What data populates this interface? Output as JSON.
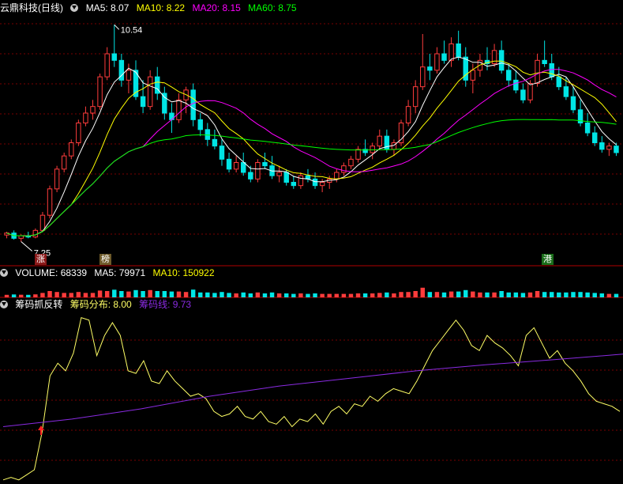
{
  "panels": {
    "main": {
      "title": "云鼎科技(日线)",
      "ma5": "MA5: 8.07",
      "ma10": "MA10: 8.22",
      "ma20": "MA20: 8.15",
      "ma60": "MA60: 8.75",
      "high_label": "10.54",
      "low_label": "7.25",
      "tags": [
        "涨",
        "榜",
        "港"
      ]
    },
    "volume": {
      "title": "VOLUME: 68339",
      "ma5": "MA5: 79971",
      "ma10": "MA10: 150922"
    },
    "indicator": {
      "title": "筹码抓反转",
      "dist": "筹码分布: 8.00",
      "line": "筹码线: 9.73"
    }
  },
  "colors": {
    "up": "#ff3c3c",
    "down": "#00e5e5",
    "ma5": "#ffffff",
    "ma10": "#ffff00",
    "ma20": "#ff00ff",
    "ma60": "#00ff00",
    "dist": "#ffff66",
    "line": "#8a2be2",
    "grid": "#7a0000",
    "sep": "#b00000"
  },
  "chart_data": [
    {
      "type": "candlestick",
      "title": "云鼎科技(日线)",
      "ylim": [
        7.1,
        10.7
      ],
      "highest": 10.54,
      "lowest": 7.25,
      "ohlc": [
        [
          7.35,
          7.4,
          7.3,
          7.38
        ],
        [
          7.38,
          7.42,
          7.28,
          7.3
        ],
        [
          7.3,
          7.36,
          7.25,
          7.34
        ],
        [
          7.34,
          7.4,
          7.3,
          7.32
        ],
        [
          7.32,
          7.45,
          7.3,
          7.42
        ],
        [
          7.42,
          7.7,
          7.4,
          7.65
        ],
        [
          7.65,
          8.1,
          7.6,
          8.05
        ],
        [
          8.05,
          8.4,
          8.0,
          8.35
        ],
        [
          8.35,
          8.6,
          8.3,
          8.55
        ],
        [
          8.55,
          8.8,
          8.5,
          8.75
        ],
        [
          8.75,
          9.1,
          8.7,
          9.05
        ],
        [
          9.05,
          9.3,
          9.0,
          9.2
        ],
        [
          9.2,
          9.4,
          9.1,
          9.3
        ],
        [
          9.3,
          9.8,
          9.25,
          9.75
        ],
        [
          9.75,
          10.2,
          9.7,
          10.1
        ],
        [
          10.1,
          10.54,
          9.9,
          10.0
        ],
        [
          10.0,
          10.1,
          9.6,
          9.7
        ],
        [
          9.7,
          9.95,
          9.5,
          9.85
        ],
        [
          9.85,
          10.0,
          9.4,
          9.45
        ],
        [
          9.45,
          9.7,
          9.2,
          9.3
        ],
        [
          9.3,
          9.85,
          9.25,
          9.75
        ],
        [
          9.75,
          9.9,
          9.4,
          9.5
        ],
        [
          9.5,
          9.6,
          9.1,
          9.2
        ],
        [
          9.2,
          9.35,
          8.9,
          9.1
        ],
        [
          9.1,
          9.5,
          9.05,
          9.4
        ],
        [
          9.4,
          9.6,
          9.2,
          9.55
        ],
        [
          9.55,
          9.65,
          9.0,
          9.1
        ],
        [
          9.1,
          9.2,
          8.85,
          8.95
        ],
        [
          8.95,
          9.05,
          8.7,
          8.8
        ],
        [
          8.8,
          8.95,
          8.65,
          8.7
        ],
        [
          8.7,
          8.8,
          8.4,
          8.5
        ],
        [
          8.5,
          8.6,
          8.3,
          8.35
        ],
        [
          8.35,
          8.55,
          8.3,
          8.45
        ],
        [
          8.45,
          8.6,
          8.25,
          8.3
        ],
        [
          8.3,
          8.4,
          8.15,
          8.2
        ],
        [
          8.2,
          8.5,
          8.15,
          8.45
        ],
        [
          8.45,
          8.6,
          8.35,
          8.4
        ],
        [
          8.4,
          8.55,
          8.2,
          8.25
        ],
        [
          8.25,
          8.4,
          8.15,
          8.3
        ],
        [
          8.3,
          8.35,
          8.1,
          8.15
        ],
        [
          8.15,
          8.25,
          8.05,
          8.1
        ],
        [
          8.1,
          8.3,
          8.05,
          8.25
        ],
        [
          8.25,
          8.35,
          8.15,
          8.2
        ],
        [
          8.2,
          8.3,
          8.05,
          8.1
        ],
        [
          8.1,
          8.2,
          8.0,
          8.15
        ],
        [
          8.15,
          8.25,
          8.05,
          8.2
        ],
        [
          8.2,
          8.35,
          8.15,
          8.3
        ],
        [
          8.3,
          8.45,
          8.25,
          8.4
        ],
        [
          8.4,
          8.55,
          8.35,
          8.5
        ],
        [
          8.5,
          8.7,
          8.45,
          8.65
        ],
        [
          8.65,
          8.8,
          8.55,
          8.6
        ],
        [
          8.6,
          8.75,
          8.5,
          8.7
        ],
        [
          8.7,
          8.95,
          8.65,
          8.85
        ],
        [
          8.85,
          8.95,
          8.6,
          8.65
        ],
        [
          8.65,
          8.8,
          8.55,
          8.75
        ],
        [
          8.75,
          9.1,
          8.7,
          9.05
        ],
        [
          9.05,
          9.4,
          9.0,
          9.3
        ],
        [
          9.3,
          9.7,
          9.2,
          9.6
        ],
        [
          9.6,
          10.4,
          9.55,
          9.9
        ],
        [
          9.9,
          10.1,
          9.7,
          9.85
        ],
        [
          9.85,
          10.2,
          9.8,
          10.1
        ],
        [
          10.1,
          10.3,
          9.95,
          10.0
        ],
        [
          10.0,
          10.35,
          9.9,
          10.25
        ],
        [
          10.25,
          10.45,
          10.0,
          10.05
        ],
        [
          10.05,
          10.2,
          9.6,
          9.7
        ],
        [
          9.7,
          9.95,
          9.5,
          9.85
        ],
        [
          9.85,
          10.1,
          9.75,
          10.0
        ],
        [
          10.0,
          10.2,
          9.85,
          9.95
        ],
        [
          9.95,
          10.25,
          9.9,
          10.15
        ],
        [
          10.15,
          10.3,
          9.8,
          9.85
        ],
        [
          9.85,
          9.95,
          9.6,
          9.7
        ],
        [
          9.7,
          9.85,
          9.5,
          9.55
        ],
        [
          9.55,
          9.65,
          9.35,
          9.4
        ],
        [
          9.4,
          9.7,
          9.35,
          9.65
        ],
        [
          9.65,
          10.1,
          9.6,
          10.0
        ],
        [
          10.0,
          10.3,
          9.9,
          9.95
        ],
        [
          9.95,
          10.1,
          9.7,
          9.75
        ],
        [
          9.75,
          9.9,
          9.55,
          9.6
        ],
        [
          9.6,
          9.75,
          9.4,
          9.45
        ],
        [
          9.45,
          9.6,
          9.2,
          9.25
        ],
        [
          9.25,
          9.4,
          9.0,
          9.05
        ],
        [
          9.05,
          9.2,
          8.85,
          8.9
        ],
        [
          8.9,
          9.0,
          8.7,
          8.75
        ],
        [
          8.75,
          8.85,
          8.6,
          8.65
        ],
        [
          8.65,
          8.75,
          8.55,
          8.7
        ],
        [
          8.7,
          8.75,
          8.55,
          8.6
        ]
      ],
      "ma_values": {
        "MA5": 8.07,
        "MA10": 8.22,
        "MA20": 8.15,
        "MA60": 8.75
      }
    },
    {
      "type": "bar",
      "title": "VOLUME",
      "values_label": {
        "VOLUME": 68339,
        "MA5": 79971,
        "MA10": 150922
      }
    },
    {
      "type": "line",
      "title": "筹码抓反转",
      "ylim": [
        7.2,
        10.6
      ],
      "series": [
        {
          "name": "筹码分布",
          "values": [
            7.25,
            7.3,
            7.25,
            7.35,
            7.45,
            8.2,
            9.3,
            9.55,
            9.4,
            9.75,
            10.45,
            10.4,
            9.7,
            10.1,
            10.35,
            10.1,
            9.4,
            9.35,
            9.6,
            9.2,
            9.15,
            9.4,
            9.2,
            9.05,
            8.9,
            8.95,
            8.85,
            8.6,
            8.5,
            8.55,
            8.7,
            8.5,
            8.45,
            8.6,
            8.4,
            8.35,
            8.5,
            8.3,
            8.45,
            8.4,
            8.55,
            8.35,
            8.6,
            8.7,
            8.55,
            8.75,
            8.7,
            8.9,
            8.8,
            8.95,
            9.05,
            9.0,
            8.95,
            9.2,
            9.5,
            9.8,
            10.0,
            10.2,
            10.4,
            10.2,
            9.9,
            9.8,
            10.1,
            9.95,
            9.85,
            9.7,
            9.5,
            10.1,
            10.25,
            9.95,
            9.65,
            9.8,
            9.55,
            9.4,
            9.2,
            8.95,
            8.8,
            8.75,
            8.7,
            8.6
          ],
          "final": 8.0
        },
        {
          "name": "筹码线",
          "values": [
            8.3,
            8.45,
            8.65,
            8.9,
            9.1,
            9.25,
            9.4,
            9.52,
            9.62,
            9.73
          ],
          "final": 9.73
        }
      ]
    }
  ]
}
